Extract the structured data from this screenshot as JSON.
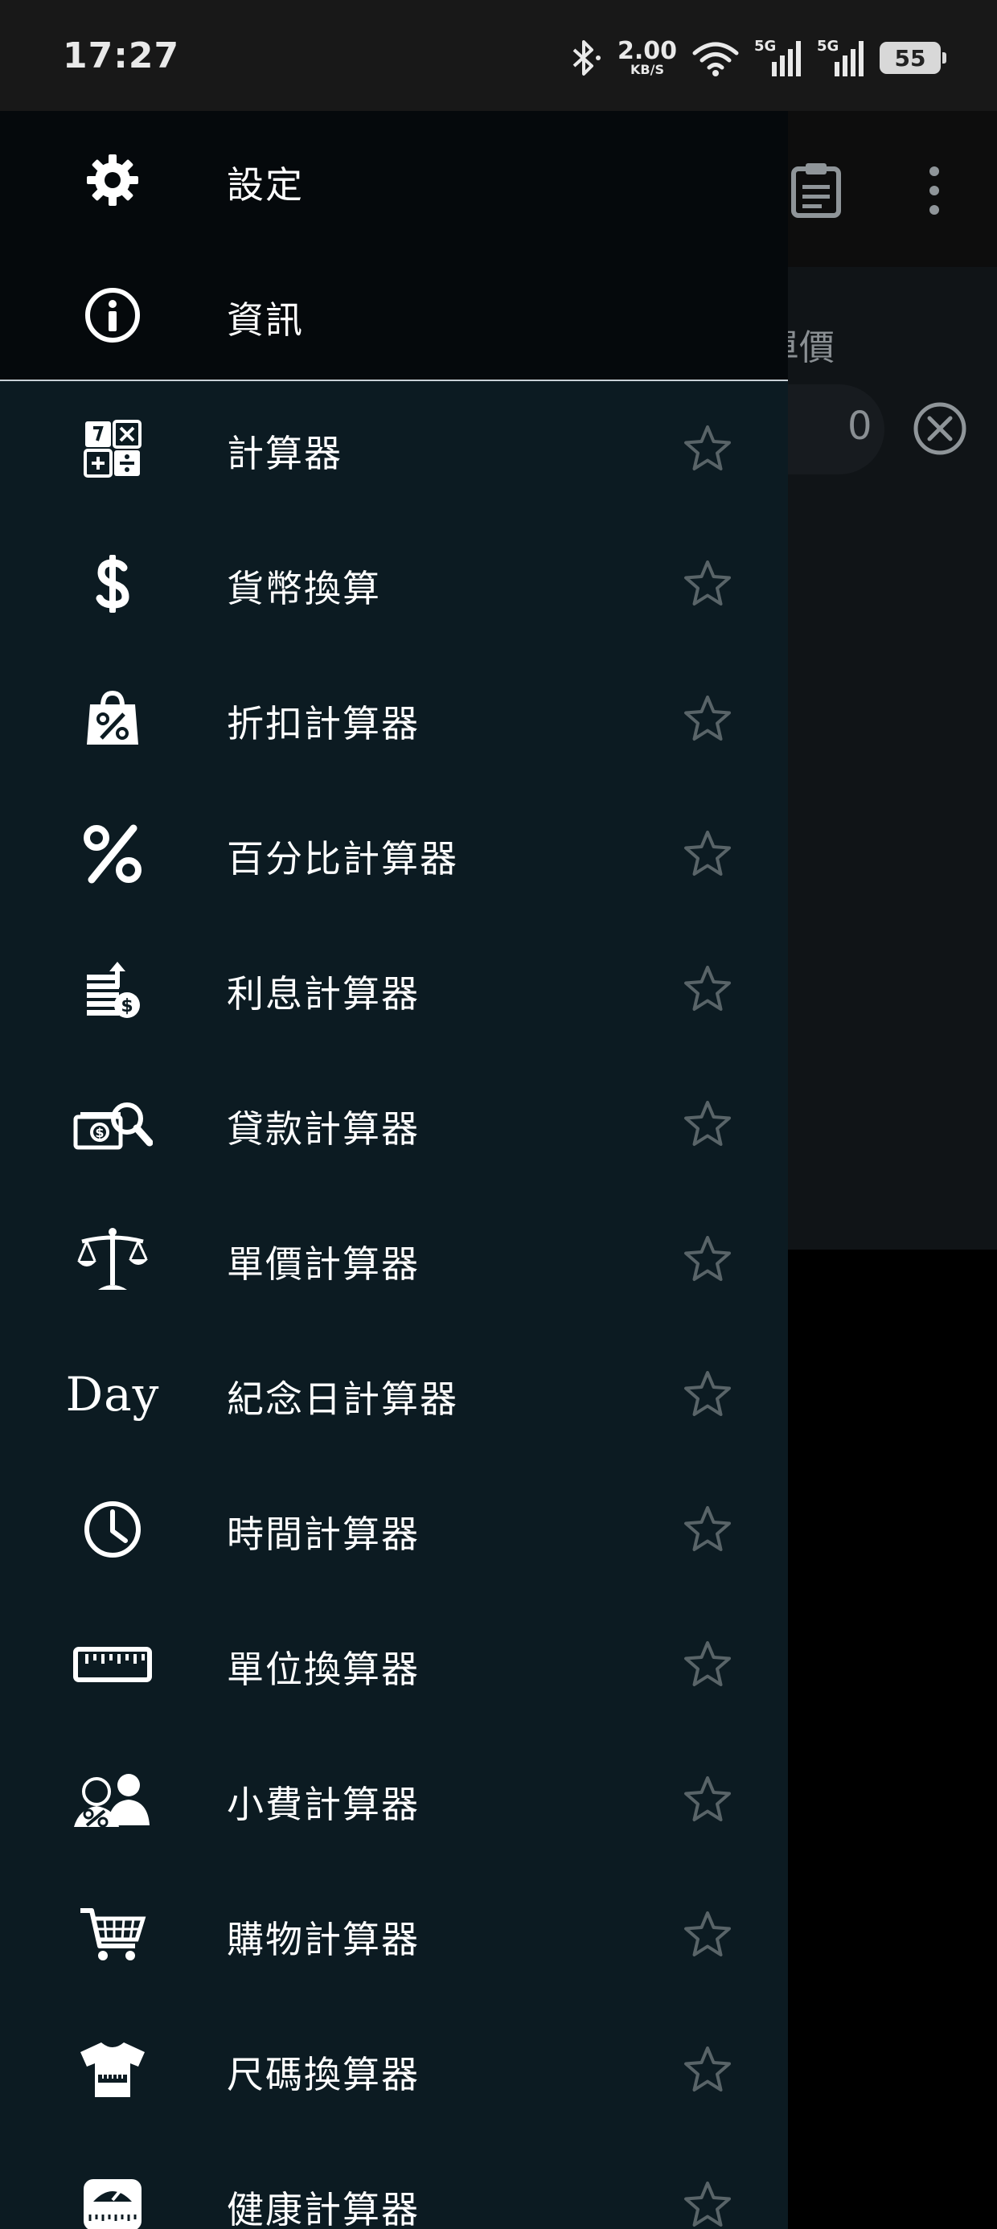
{
  "status_bar": {
    "time": "17:27",
    "net_speed": "2.00",
    "net_unit": "KB/S",
    "sim1": "5G",
    "sim2": "5G",
    "battery": "55"
  },
  "background_app": {
    "field_label": "單價",
    "field_value": "0"
  },
  "drawer": {
    "top_items": [
      {
        "label": "設定",
        "icon": "gear-icon"
      },
      {
        "label": "資訊",
        "icon": "info-icon"
      }
    ],
    "items": [
      {
        "label": "計算器",
        "icon": "calculator-icon"
      },
      {
        "label": "貨幣換算",
        "icon": "dollar-icon"
      },
      {
        "label": "折扣計算器",
        "icon": "discount-bag-icon"
      },
      {
        "label": "百分比計算器",
        "icon": "percent-icon"
      },
      {
        "label": "利息計算器",
        "icon": "interest-icon"
      },
      {
        "label": "貸款計算器",
        "icon": "loan-icon"
      },
      {
        "label": "單價計算器",
        "icon": "scale-icon"
      },
      {
        "label": "紀念日計算器",
        "icon": "day-icon",
        "icon_text": "Day"
      },
      {
        "label": "時間計算器",
        "icon": "clock-icon"
      },
      {
        "label": "單位換算器",
        "icon": "ruler-icon"
      },
      {
        "label": "小費計算器",
        "icon": "tip-icon"
      },
      {
        "label": "購物計算器",
        "icon": "cart-icon"
      },
      {
        "label": "尺碼換算器",
        "icon": "tshirt-icon"
      },
      {
        "label": "健康計算器",
        "icon": "weight-scale-icon"
      }
    ]
  },
  "colors": {
    "drawer_bg": "#0c1b22",
    "drawer_top_bg": "#05090c",
    "star_outline": "#596468",
    "text": "#ffffff"
  }
}
